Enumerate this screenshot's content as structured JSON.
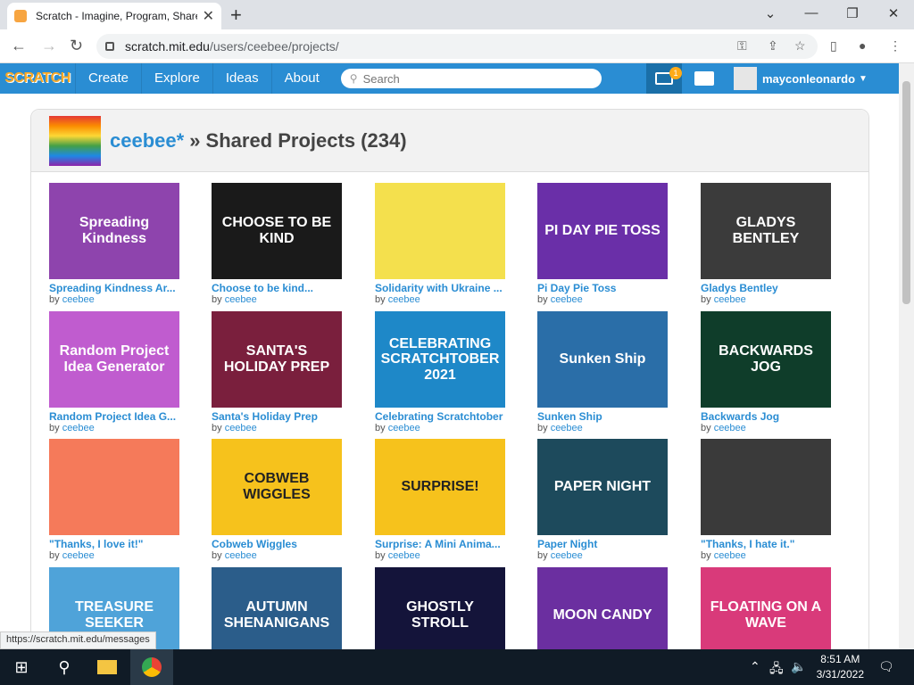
{
  "browser": {
    "tab_title": "Scratch - Imagine, Program, Share",
    "url_host": "scratch.mit.edu",
    "url_path": "/users/ceebee/projects/",
    "status_url": "https://scratch.mit.edu/messages"
  },
  "scratch_nav": {
    "logo": "SCRATCH",
    "links": [
      "Create",
      "Explore",
      "Ideas",
      "About"
    ],
    "search_placeholder": "Search",
    "message_count": "1",
    "username": "mayconleonardo"
  },
  "header": {
    "owner": "ceebee*",
    "title_rest": "» Shared Projects (234)"
  },
  "by_label": "by",
  "projects": [
    {
      "title": "Spreading Kindness Ar...",
      "author": "ceebee",
      "thumb_text": "Spreading Kindness",
      "bg": "#8e44ad"
    },
    {
      "title": "Choose to be kind...",
      "author": "ceebee",
      "thumb_text": "CHOOSE TO BE KIND",
      "bg": "#1a1a1a"
    },
    {
      "title": "Solidarity with Ukraine ...",
      "author": "ceebee",
      "thumb_text": "",
      "bg": "#f4e04d"
    },
    {
      "title": "Pi Day Pie Toss",
      "author": "ceebee",
      "thumb_text": "PI DAY PIE TOSS",
      "bg": "#6a2fa8"
    },
    {
      "title": "Gladys Bentley",
      "author": "ceebee",
      "thumb_text": "GLADYS BENTLEY",
      "bg": "#3b3b3b"
    },
    {
      "title": "Random Project Idea G...",
      "author": "ceebee",
      "thumb_text": "Random Project Idea Generator",
      "bg": "#c05ccf"
    },
    {
      "title": "Santa's Holiday Prep",
      "author": "ceebee",
      "thumb_text": "SANTA'S HOLIDAY PREP",
      "bg": "#7a1f3d"
    },
    {
      "title": "Celebrating Scratchtober",
      "author": "ceebee",
      "thumb_text": "CELEBRATING SCRATCHTOBER 2021",
      "bg": "#1e88c8"
    },
    {
      "title": "Sunken Ship",
      "author": "ceebee",
      "thumb_text": "Sunken Ship",
      "bg": "#2a6ea8"
    },
    {
      "title": "Backwards Jog",
      "author": "ceebee",
      "thumb_text": "BACKWARDS JOG",
      "bg": "#0f3d2a"
    },
    {
      "title": "\"Thanks, I love it!\"",
      "author": "ceebee",
      "thumb_text": "",
      "bg": "#f57a5a"
    },
    {
      "title": "Cobweb Wiggles",
      "author": "ceebee",
      "thumb_text": "COBWEB WIGGLES",
      "bg": "#f6c21c"
    },
    {
      "title": "Surprise: A Mini Anima...",
      "author": "ceebee",
      "thumb_text": "SURPRISE!",
      "bg": "#f6c21c"
    },
    {
      "title": "Paper Night",
      "author": "ceebee",
      "thumb_text": "PAPER NIGHT",
      "bg": "#1d4a5c"
    },
    {
      "title": "\"Thanks, I hate it.\"",
      "author": "ceebee",
      "thumb_text": "",
      "bg": "#3a3a3a"
    },
    {
      "title": "",
      "author": "",
      "thumb_text": "TREASURE SEEKER",
      "bg": "#4fa3d9"
    },
    {
      "title": "",
      "author": "",
      "thumb_text": "AUTUMN SHENANIGANS",
      "bg": "#2b5d8a"
    },
    {
      "title": "",
      "author": "",
      "thumb_text": "GHOSTLY STROLL",
      "bg": "#14143a"
    },
    {
      "title": "",
      "author": "",
      "thumb_text": "MOON CANDY",
      "bg": "#6b2fa0"
    },
    {
      "title": "",
      "author": "",
      "thumb_text": "FLOATING ON A WAVE",
      "bg": "#d93a7a"
    }
  ],
  "taskbar": {
    "time": "8:51 AM",
    "date": "3/31/2022"
  }
}
